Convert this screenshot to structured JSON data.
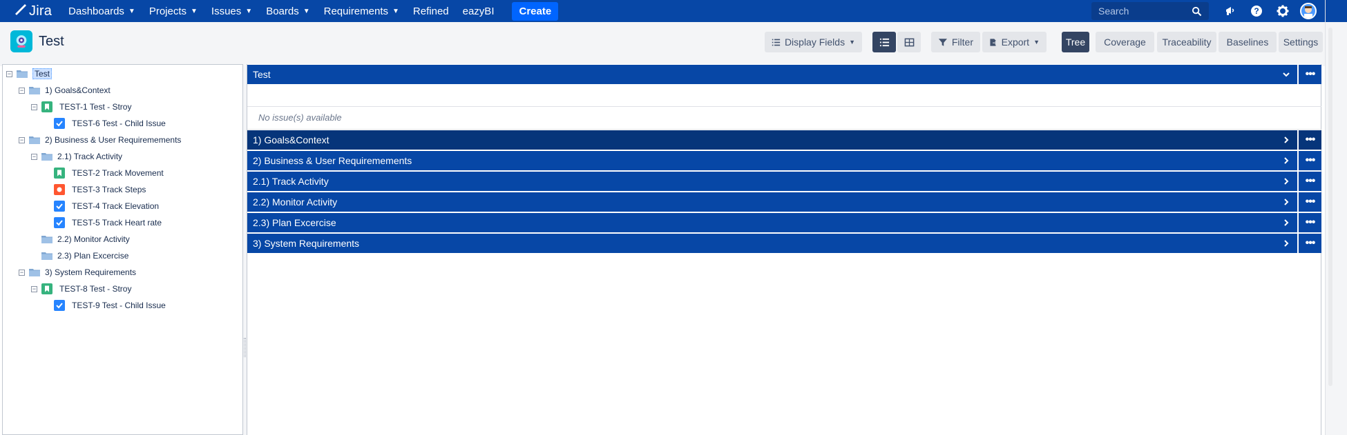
{
  "nav": {
    "logo_text": "Jira",
    "items": [
      {
        "label": "Dashboards",
        "has_caret": true
      },
      {
        "label": "Projects",
        "has_caret": true
      },
      {
        "label": "Issues",
        "has_caret": true
      },
      {
        "label": "Boards",
        "has_caret": true
      },
      {
        "label": "Requirements",
        "has_caret": true
      },
      {
        "label": "Refined",
        "has_caret": false
      },
      {
        "label": "eazyBI",
        "has_caret": false
      }
    ],
    "create_label": "Create",
    "search_placeholder": "Search",
    "right_icons": [
      "notifications-icon",
      "help-icon",
      "settings-icon"
    ]
  },
  "header": {
    "project_title": "Test",
    "display_fields_label": "Display Fields",
    "filter_label": "Filter",
    "export_label": "Export",
    "tabs": [
      "Tree",
      "Coverage",
      "Traceability",
      "Baselines",
      "Settings"
    ],
    "active_tab": "Tree"
  },
  "tree": {
    "nodes": [
      {
        "label": "Test",
        "type": "root",
        "level": 0,
        "toggle": "−",
        "selected": true
      },
      {
        "label": "1) Goals&Context",
        "type": "folder",
        "level": 1,
        "toggle": "−"
      },
      {
        "label": "TEST-1 Test - Stroy",
        "type": "story",
        "level": 2,
        "toggle": "−"
      },
      {
        "label": "TEST-6 Test - Child Issue",
        "type": "task",
        "level": 3,
        "toggle": ""
      },
      {
        "label": "2) Business & User Requiremements",
        "type": "folder",
        "level": 1,
        "toggle": "−"
      },
      {
        "label": "2.1) Track Activity",
        "type": "folder",
        "level": 2,
        "toggle": "−"
      },
      {
        "label": "TEST-2 Track Movement",
        "type": "story",
        "level": 3,
        "toggle": ""
      },
      {
        "label": "TEST-3 Track Steps",
        "type": "bug",
        "level": 3,
        "toggle": ""
      },
      {
        "label": "TEST-4 Track Elevation",
        "type": "task",
        "level": 3,
        "toggle": ""
      },
      {
        "label": "TEST-5 Track Heart rate",
        "type": "task",
        "level": 3,
        "toggle": ""
      },
      {
        "label": "2.2) Monitor Activity",
        "type": "folder",
        "level": 2,
        "toggle": ""
      },
      {
        "label": "2.3) Plan Excercise",
        "type": "folder",
        "level": 2,
        "toggle": ""
      },
      {
        "label": "3) System Requirements",
        "type": "folder",
        "level": 1,
        "toggle": "−"
      },
      {
        "label": "TEST-8 Test - Stroy",
        "type": "story",
        "level": 2,
        "toggle": "−"
      },
      {
        "label": "TEST-9 Test - Child Issue",
        "type": "task",
        "level": 3,
        "toggle": ""
      }
    ]
  },
  "document": {
    "root_header": "Test",
    "no_issues_text": "No issue(s) available",
    "sections": [
      "1) Goals&Context",
      "2) Business & User Requiremements",
      "2.1) Track Activity",
      "2.2) Monitor Activity",
      "2.3) Plan Excercise",
      "3) System Requirements"
    ],
    "more_label": "•••"
  },
  "colors": {
    "nav_bg": "#0747a6",
    "create_bg": "#0065ff",
    "section_bg": "#0747a6",
    "active_tab_bg": "#344563"
  }
}
